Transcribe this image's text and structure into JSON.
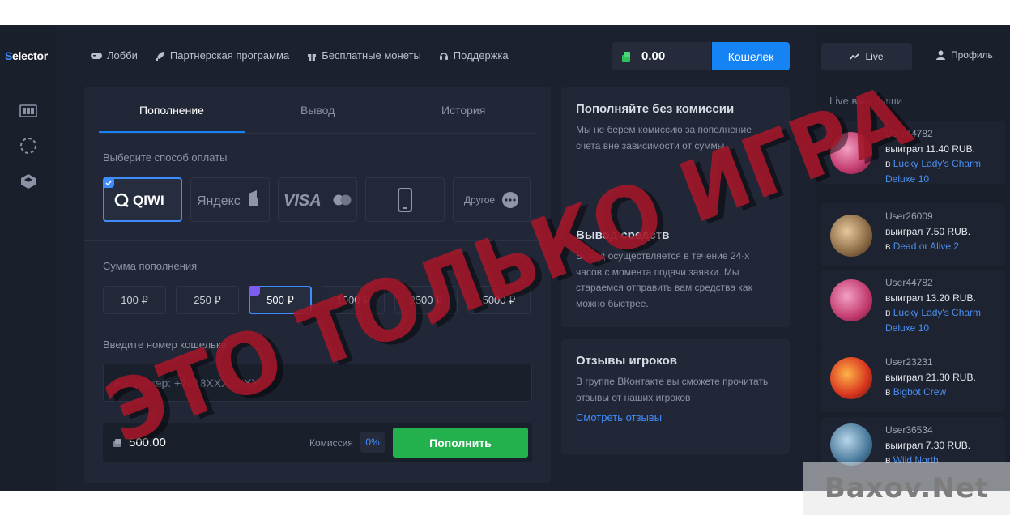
{
  "brand": {
    "logo_text": "elector",
    "logo_s": "S"
  },
  "nav": {
    "items": [
      {
        "label": "Лобби",
        "icon": "gamepad-icon"
      },
      {
        "label": "Партнерская программа",
        "icon": "rocket-icon"
      },
      {
        "label": "Бесплатные монеты",
        "icon": "gift-icon"
      },
      {
        "label": "Поддержка",
        "icon": "headset-icon"
      }
    ]
  },
  "header": {
    "balance": "0.00",
    "wallet_label": "Кошелек",
    "live_label": "Live",
    "profile_label": "Профиль"
  },
  "tabs": [
    "Пополнение",
    "Вывод",
    "История"
  ],
  "deposit": {
    "method_label": "Выберите способ оплаты",
    "methods": [
      {
        "name": "QIWI",
        "selected": true
      },
      {
        "name": "Яндекс",
        "selected": false
      },
      {
        "name": "VISA",
        "selected": false
      },
      {
        "name": "Mobile",
        "selected": false
      },
      {
        "name": "Другое",
        "selected": false
      }
    ],
    "amount_label": "Сумма пополнения",
    "amounts": [
      "100 ₽",
      "250 ₽",
      "500 ₽",
      "1000 ₽",
      "2500 ₽",
      "5000 ₽"
    ],
    "selected_amount_index": 2,
    "wallet_label": "Введите номер кошелька",
    "wallet_placeholder": "Например: +7918XXXXXXX",
    "sum_value": "500.00",
    "fee_label": "Комиссия",
    "fee_value": "0%",
    "submit_label": "Пополнить"
  },
  "info": {
    "card1_title": "Пополняйте без комиссии",
    "card1_text": "Мы не берем комиссию за пополнение счета вне зависимости от суммы",
    "card2_title": "Вывод средств",
    "card2_text": "Вывод осуществляется в течение 24-х часов с момента подачи заявки. Мы стараемся отправить вам средства как можно быстрее.",
    "card3_title": "Отзывы игроков",
    "card3_text": "В группе ВКонтакте вы сможете прочитать отзывы от наших игроков",
    "card3_link": "Смотреть отзывы"
  },
  "live": {
    "title": "Live выигрыши",
    "in_word": "в",
    "wins": [
      {
        "user": "User44782",
        "won": "выиграл 11.40 RUB.",
        "game": "Lucky Lady's Charm Deluxe 10",
        "color": "#c23b6e"
      },
      {
        "user": "User26009",
        "won": "выиграл 7.50 RUB.",
        "game": "Dead or Alive 2",
        "color": "#8a6a45"
      },
      {
        "user": "User44782",
        "won": "выиграл 13.20 RUB.",
        "game": "Lucky Lady's Charm Deluxe 10",
        "color": "#c23b6e"
      },
      {
        "user": "User23231",
        "won": "выиграл 21.30 RUB.",
        "game": "Bigbot Crew",
        "color": "#d6331f"
      },
      {
        "user": "User36534",
        "won": "выиграл 7.30 RUB.",
        "game": "Wild North",
        "color": "#4a7a9c"
      }
    ]
  },
  "overlay": {
    "stamp_text": "ЭТО ТОЛЬКО ИГРА",
    "stamp_color": "#a3172a",
    "watermark": "Baxov.Net"
  }
}
